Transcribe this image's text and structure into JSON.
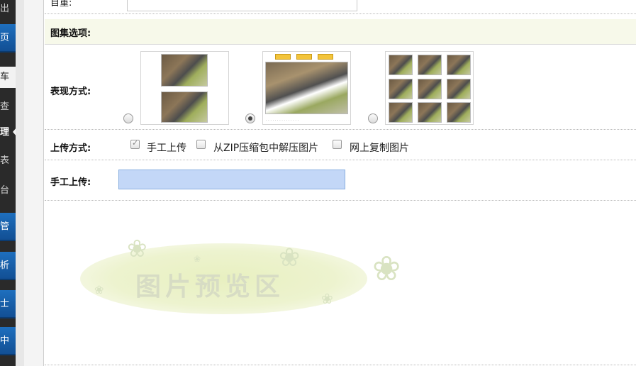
{
  "sidebar": {
    "items": [
      "出",
      "页",
      "车",
      "查",
      "理",
      "表",
      "台",
      "管",
      "析",
      "士",
      "中"
    ]
  },
  "form": {
    "top_label": "目重:",
    "section_title": "图集选项:",
    "display_mode": {
      "label": "表现方式:",
      "selected_index": 1
    },
    "upload_mode": {
      "label": "上传方式:",
      "options": [
        {
          "label": "手工上传",
          "checked": true,
          "disabled": true
        },
        {
          "label": "从ZIP压缩包中解压图片",
          "checked": false
        },
        {
          "label": "网上复制图片",
          "checked": false
        }
      ]
    },
    "manual_upload": {
      "label": "手工上传:"
    },
    "preview": {
      "text": "图片预览区"
    }
  },
  "colors": {
    "sidebar_blue": "#1e6fbe",
    "section_bg": "#f7f9ea",
    "file_field": "#c3d7f7",
    "preview_blob": "#e8f0c0"
  }
}
